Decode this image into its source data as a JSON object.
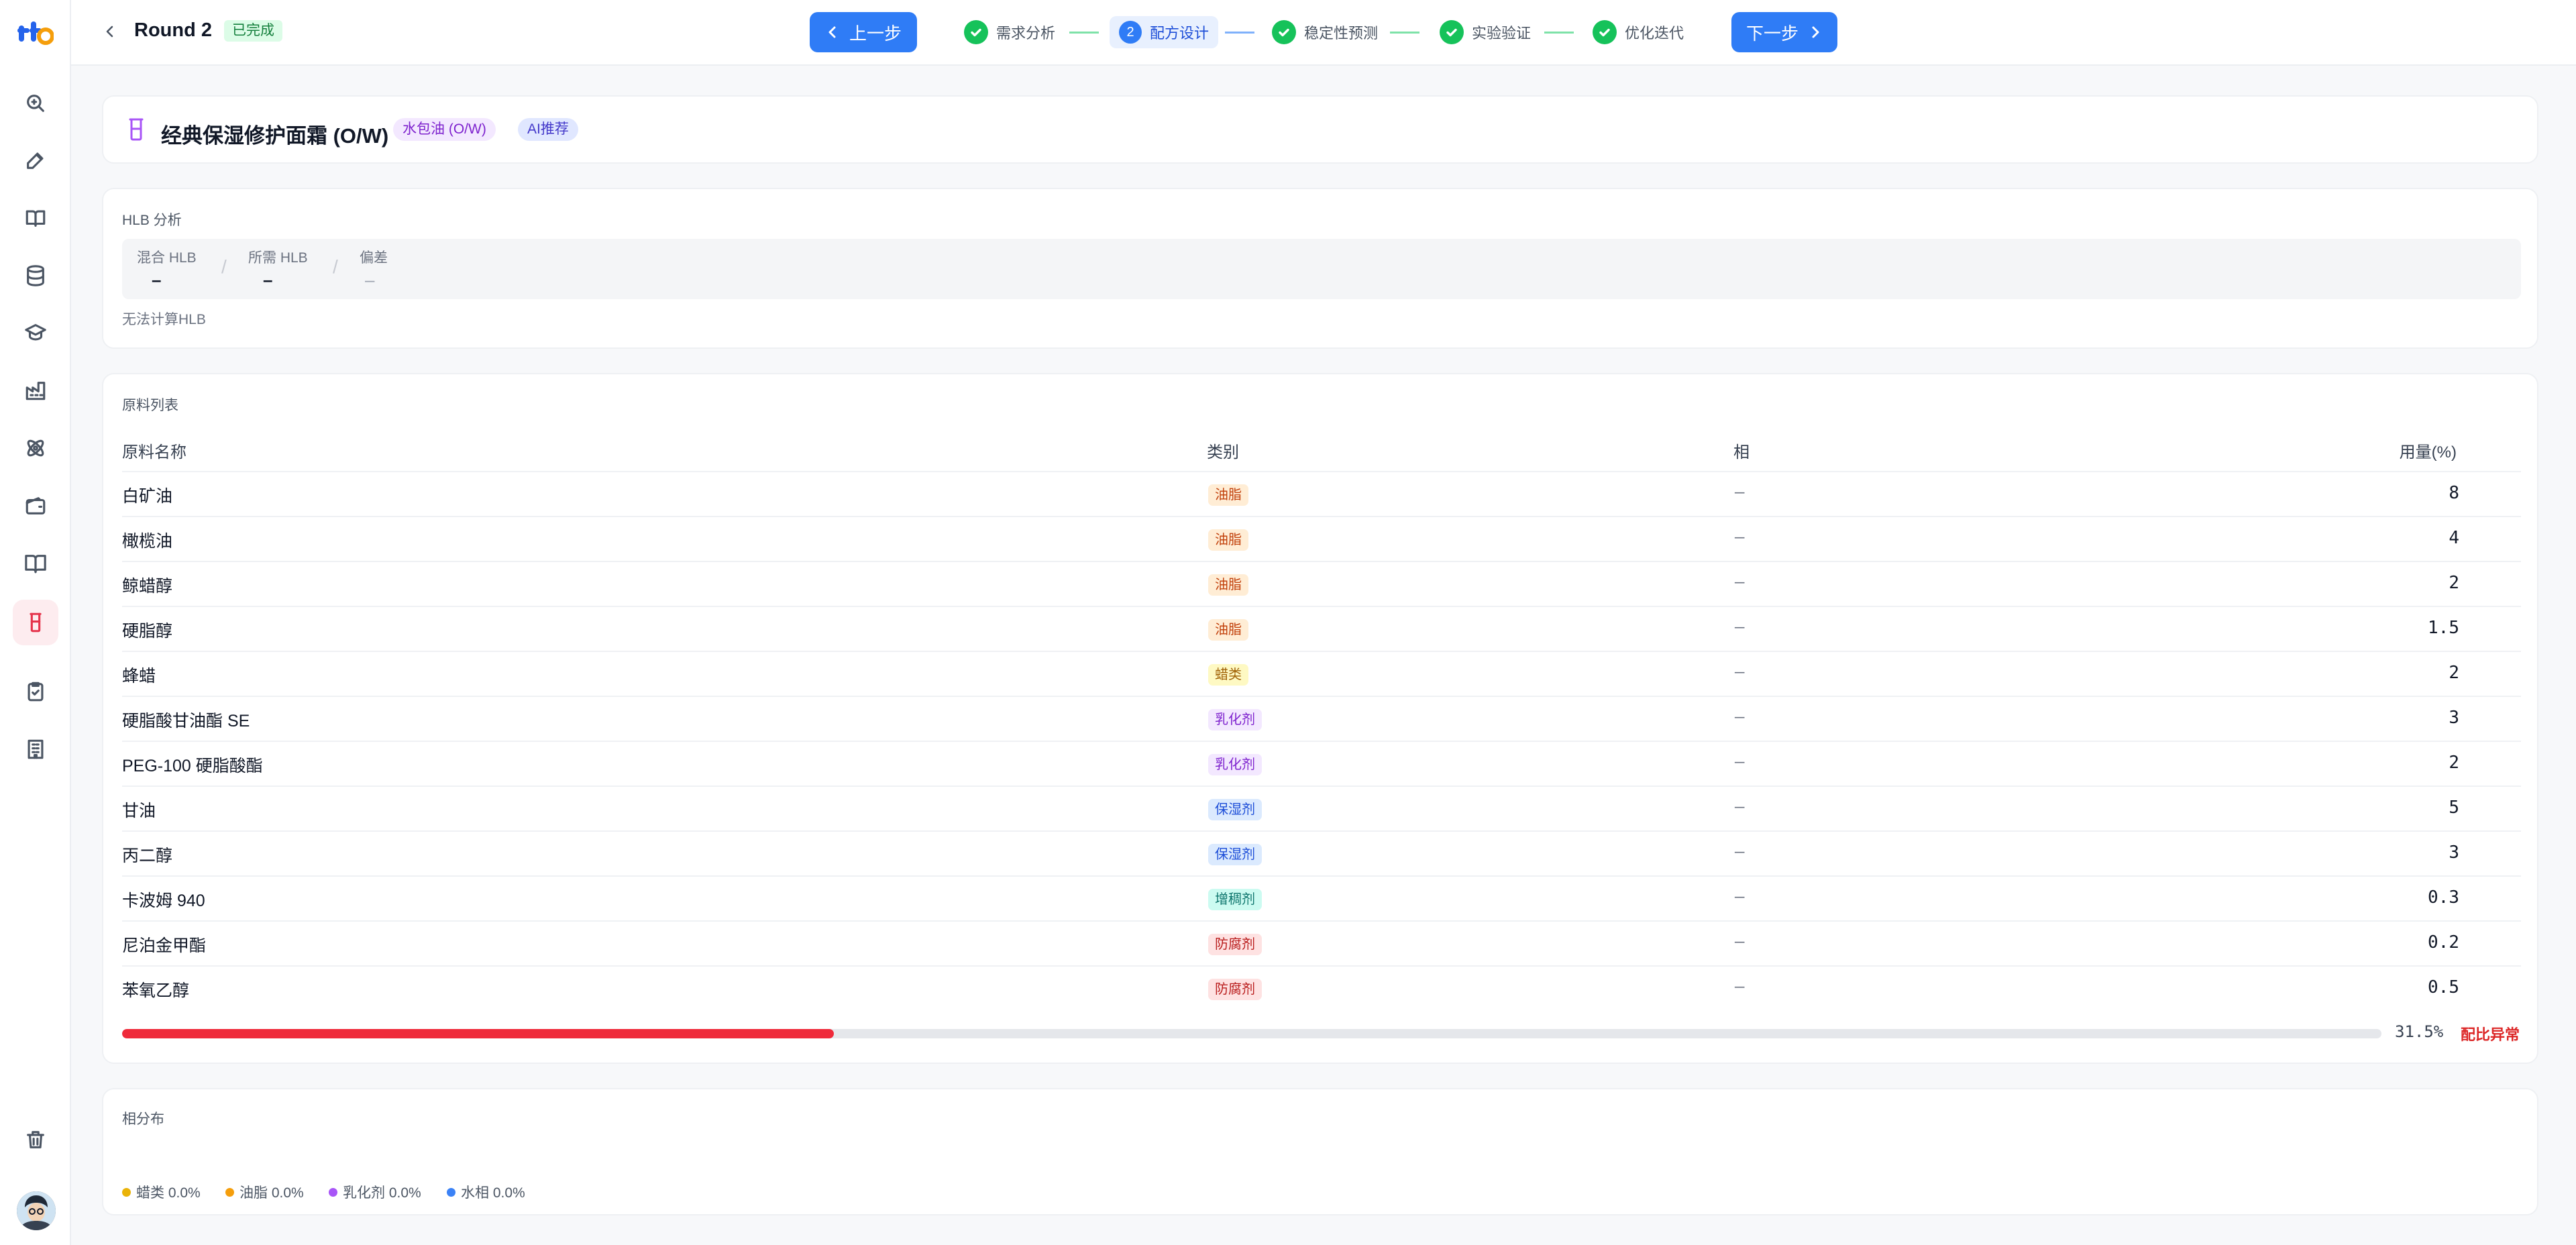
{
  "header": {
    "round_title": "Round 2",
    "status": "已完成",
    "prev_label": "上一步",
    "next_label": "下一步",
    "steps": [
      {
        "label": "需求分析",
        "state": "done"
      },
      {
        "label": "配方设计",
        "state": "current",
        "number": "2"
      },
      {
        "label": "稳定性预测",
        "state": "done"
      },
      {
        "label": "实验验证",
        "state": "done"
      },
      {
        "label": "优化迭代",
        "state": "done"
      }
    ]
  },
  "formula": {
    "title": "经典保湿修护面霜 (O/W)",
    "type_tag": "水包油 (O/W)",
    "ai_tag": "AI推荐"
  },
  "hlb": {
    "section_label": "HLB 分析",
    "mixed_label": "混合 HLB",
    "mixed_value": "–",
    "required_label": "所需 HLB",
    "required_value": "–",
    "deviation_label": "偏差",
    "deviation_value": "–",
    "note": "无法计算HLB"
  },
  "ingredients": {
    "section_label": "原料列表",
    "headers": {
      "name": "原料名称",
      "category": "类别",
      "phase": "相",
      "amount": "用量(%)"
    },
    "rows": [
      {
        "name": "白矿油",
        "category": "油脂",
        "phase": "—",
        "amount": "8"
      },
      {
        "name": "橄榄油",
        "category": "油脂",
        "phase": "—",
        "amount": "4"
      },
      {
        "name": "鲸蜡醇",
        "category": "油脂",
        "phase": "—",
        "amount": "2"
      },
      {
        "name": "硬脂醇",
        "category": "油脂",
        "phase": "—",
        "amount": "1.5"
      },
      {
        "name": "蜂蜡",
        "category": "蜡类",
        "phase": "—",
        "amount": "2"
      },
      {
        "name": "硬脂酸甘油酯 SE",
        "category": "乳化剂",
        "phase": "—",
        "amount": "3"
      },
      {
        "name": "PEG-100 硬脂酸酯",
        "category": "乳化剂",
        "phase": "—",
        "amount": "2"
      },
      {
        "name": "甘油",
        "category": "保湿剂",
        "phase": "—",
        "amount": "5"
      },
      {
        "name": "丙二醇",
        "category": "保湿剂",
        "phase": "—",
        "amount": "3"
      },
      {
        "name": "卡波姆 940",
        "category": "增稠剂",
        "phase": "—",
        "amount": "0.3"
      },
      {
        "name": "尼泊金甲酯",
        "category": "防腐剂",
        "phase": "—",
        "amount": "0.2"
      },
      {
        "name": "苯氧乙醇",
        "category": "防腐剂",
        "phase": "—",
        "amount": "0.5"
      }
    ],
    "total_progress": 0.315,
    "total_pct_label": "31.5%",
    "warning": "配比异常"
  },
  "phase_distribution": {
    "section_label": "相分布",
    "legend": [
      {
        "label": "蜡类 0.0%",
        "color": "#eab308"
      },
      {
        "label": "油脂 0.0%",
        "color": "#f59e0b"
      },
      {
        "label": "乳化剂 0.0%",
        "color": "#a855f7"
      },
      {
        "label": "水相 0.0%",
        "color": "#3b82f6"
      }
    ]
  },
  "colors": {
    "accent": "#2f7cf6",
    "success": "#16c25a",
    "danger": "#ef2a3a"
  },
  "icons": {
    "sidebar": [
      "search-icon",
      "edit-icon",
      "book-icon",
      "database-icon",
      "graduation-cap-icon",
      "factory-icon",
      "atom-icon",
      "wallet-icon",
      "book-open-icon",
      "beaker-icon",
      "clipboard-check-icon",
      "building-icon",
      "trash-icon"
    ]
  }
}
